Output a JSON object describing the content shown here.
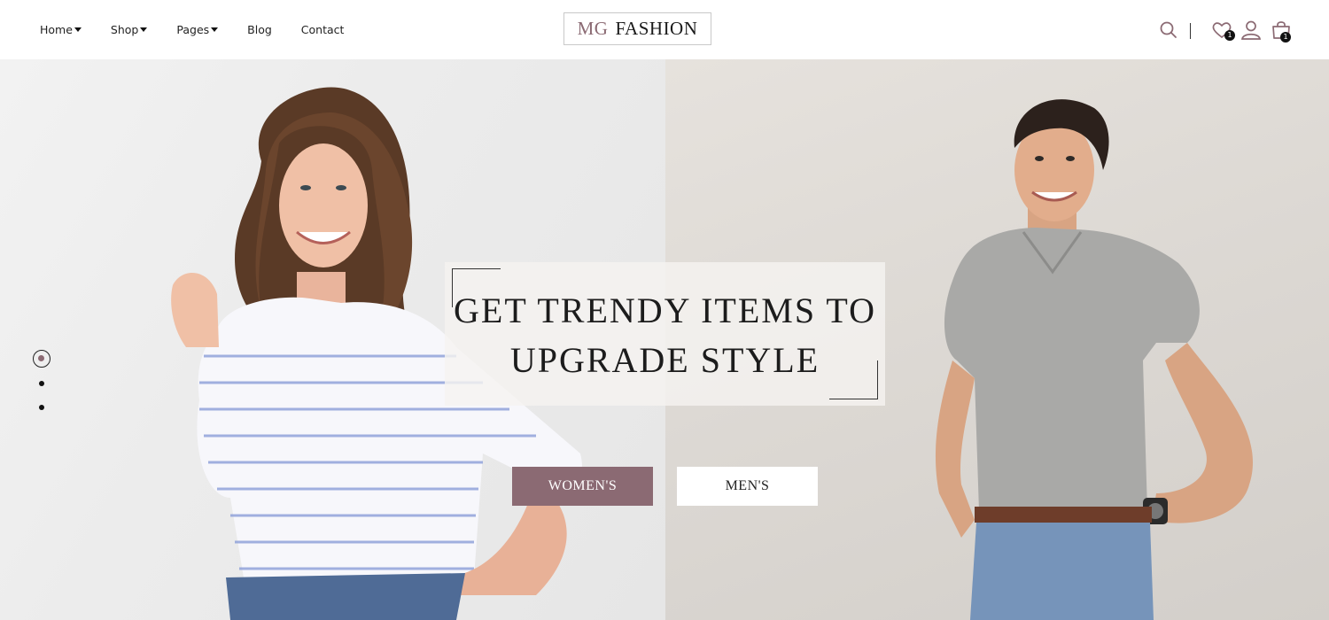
{
  "nav": {
    "home": "Home",
    "shop": "Shop",
    "pages": "Pages",
    "blog": "Blog",
    "contact": "Contact"
  },
  "logo": {
    "part1": "MG",
    "part2": "FASHION"
  },
  "header_icons": {
    "search": "search-icon",
    "wishlist": "heart-icon",
    "wishlist_count": "1",
    "account": "user-icon",
    "cart": "shopping-bag-icon",
    "cart_count": "1"
  },
  "hero": {
    "headline_line1": "GET TRENDY ITEMS TO",
    "headline_line2": "UPGRADE STYLE",
    "women_button": "WOMEN'S",
    "men_button": "MEN'S",
    "slides_total": 3,
    "active_slide": 1
  },
  "colors": {
    "accent": "#8b6a73",
    "text": "#1c1c1c",
    "left_bg": "#ececec",
    "right_bg": "#dcd8d3"
  }
}
